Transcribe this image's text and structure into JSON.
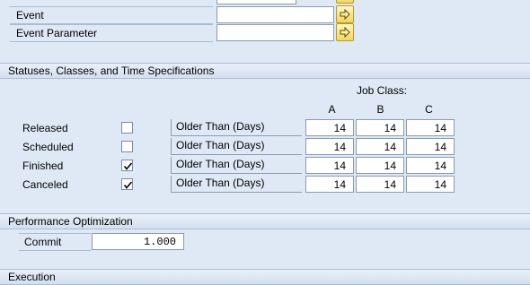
{
  "event_section": {
    "event_label": "Event",
    "event_value": "",
    "event_parameter_label": "Event Parameter",
    "event_parameter_value": ""
  },
  "statuses_section": {
    "title": "Statuses, Classes, and Time Specifications",
    "job_class_label": "Job Class:",
    "columns": [
      "A",
      "B",
      "C"
    ],
    "rows": [
      {
        "label": "Released",
        "checked": false,
        "spec": "Older Than (Days)",
        "values": [
          "14",
          "14",
          "14"
        ]
      },
      {
        "label": "Scheduled",
        "checked": false,
        "spec": "Older Than (Days)",
        "values": [
          "14",
          "14",
          "14"
        ]
      },
      {
        "label": "Finished",
        "checked": true,
        "spec": "Older Than (Days)",
        "values": [
          "14",
          "14",
          "14"
        ]
      },
      {
        "label": "Canceled",
        "checked": true,
        "spec": "Older Than (Days)",
        "values": [
          "14",
          "14",
          "14"
        ]
      }
    ]
  },
  "performance_section": {
    "title": "Performance Optimization",
    "commit_label": "Commit",
    "commit_value": "1.000"
  },
  "execution_section": {
    "title": "Execution"
  },
  "icons": {
    "nav": "arrow-right-icon",
    "check": "check-icon"
  },
  "colors": {
    "background": "#dfe9f5",
    "header": "#d3e0ef",
    "border": "#a9bcd4",
    "button": "#f2d65a"
  }
}
